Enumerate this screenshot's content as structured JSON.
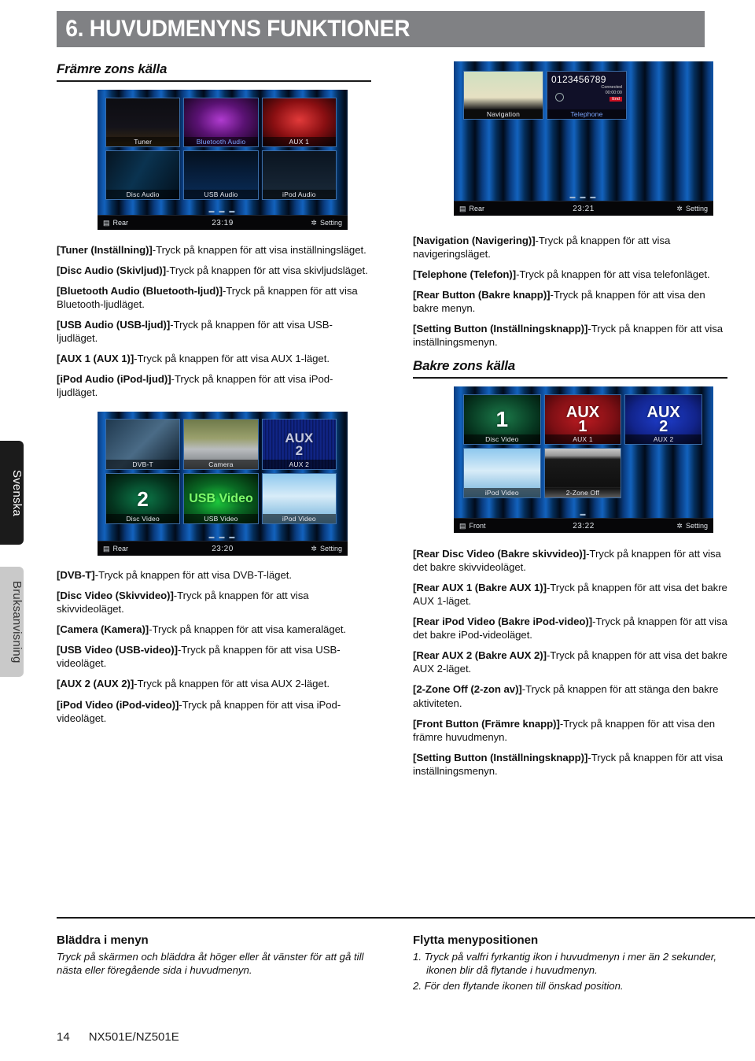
{
  "side_tabs": [
    {
      "label": "Svenska"
    },
    {
      "label": "Bruksanvisning"
    }
  ],
  "chapter": {
    "title": "6. HUVUDMENYNS FUNKTIONER",
    "bar_color": "#808184"
  },
  "left_column": {
    "heading": "Främre zons källa",
    "screenshot_front": {
      "caption_alt": "Front zone source main menu",
      "tiles": [
        {
          "label": "Tuner",
          "big": ""
        },
        {
          "label": "Bluetooth Audio",
          "big": ""
        },
        {
          "label": "AUX 1",
          "big": ""
        },
        {
          "label": "Disc Audio",
          "big": ""
        },
        {
          "label": "USB Audio",
          "big": ""
        },
        {
          "label": "iPod Audio",
          "big": ""
        }
      ],
      "status": {
        "left": "Rear",
        "time": "23:19",
        "right": "Setting"
      },
      "page_dots": "▬ ▬ ▬"
    },
    "items": [
      {
        "term": "[Tuner (Inställning)]",
        "desc": "-Tryck på knappen för att visa inställningsläget."
      },
      {
        "term": "[Disc Audio (Skivljud)]",
        "desc": "-Tryck på knappen för att visa skivljudsläget."
      },
      {
        "term": "[Bluetooth Audio (Bluetooth-ljud)]",
        "desc": "-Tryck på knappen för att visa Bluetooth-ljudläget."
      },
      {
        "term": "[USB Audio (USB-ljud)]",
        "desc": "-Tryck på knappen för att visa USB-ljudläget."
      },
      {
        "term": "[AUX 1 (AUX 1)]",
        "desc": "-Tryck på knappen för att visa AUX 1-läget."
      },
      {
        "term": "[iPod Audio (iPod-ljud)]",
        "desc": "-Tryck på knappen för att visa iPod-ljudläget."
      }
    ],
    "screenshot_video": {
      "caption_alt": "Front zone video sources main menu",
      "tiles": [
        {
          "label": "DVB-T",
          "big": ""
        },
        {
          "label": "Camera",
          "big": ""
        },
        {
          "label": "AUX 2",
          "big": "AUX\n2"
        },
        {
          "label": "Disc Video",
          "big": "2"
        },
        {
          "label": "USB Video",
          "big": "USB Video"
        },
        {
          "label": "iPod Video",
          "big": ""
        }
      ],
      "status": {
        "left": "Rear",
        "time": "23:20",
        "right": "Setting"
      },
      "page_dots": "▬ ▬ ▬"
    },
    "items2": [
      {
        "term": "[DVB-T]",
        "desc": "-Tryck på knappen för att visa DVB-T-läget."
      },
      {
        "term": "[Disc Video (Skivvideo)]",
        "desc": "-Tryck på knappen för att visa skivvideoläget."
      },
      {
        "term": "[Camera (Kamera)]",
        "desc": "-Tryck på knappen för att visa kameraläget."
      },
      {
        "term": "[USB Video (USB-video)]",
        "desc": "-Tryck på knappen för att visa USB-videoläget."
      },
      {
        "term": "[AUX 2 (AUX 2)]",
        "desc": "-Tryck på knappen för att visa AUX 2-läget."
      },
      {
        "term": "[iPod Video (iPod-video)]",
        "desc": "-Tryck på knappen för att visa iPod-videoläget."
      }
    ],
    "tip": {
      "heading": "Bläddra i menyn",
      "body": "Tryck på skärmen och bläddra åt höger eller åt vänster för att gå till nästa eller föregående sida i huvudmenyn."
    }
  },
  "right_column": {
    "screenshot_nav": {
      "caption_alt": "Navigation and Telephone main menu",
      "tiles": [
        {
          "label": "Navigation",
          "big": ""
        },
        {
          "label": "Telephone",
          "big": ""
        }
      ],
      "telephone": {
        "number": "0123456789",
        "connected_label": "Connected",
        "timer": "00:00:00",
        "end_label": "End"
      },
      "status": {
        "left": "Rear",
        "time": "23:21",
        "right": "Setting"
      },
      "page_dots": "▬ ▬ ▬"
    },
    "items": [
      {
        "term": "[Navigation (Navigering)]",
        "desc": "-Tryck på knappen för att visa navigeringsläget."
      },
      {
        "term": "[Telephone (Telefon)]",
        "desc": "-Tryck på knappen för att visa telefonläget."
      },
      {
        "term": "[Rear Button (Bakre knapp)]",
        "desc": "-Tryck på knappen för att visa den bakre menyn."
      },
      {
        "term": "[Setting Button (Inställningsknapp)]",
        "desc": "-Tryck på knappen för att visa inställningsmenyn."
      }
    ],
    "heading": "Bakre zons källa",
    "screenshot_rear": {
      "caption_alt": "Rear zone source main menu",
      "tiles": [
        {
          "label": "Disc Video",
          "big": "1"
        },
        {
          "label": "AUX 1",
          "big": "AUX\n1"
        },
        {
          "label": "AUX 2",
          "big": "AUX\n2"
        },
        {
          "label": "iPod Video",
          "big": ""
        },
        {
          "label": "2-Zone Off",
          "big": ""
        }
      ],
      "status": {
        "left": "Front",
        "time": "23:22",
        "right": "Setting"
      },
      "page_dots": "▬"
    },
    "items2": [
      {
        "term": "[Rear Disc Video (Bakre skivvideo)]",
        "desc": "-Tryck på knappen för att visa det bakre skivvideoläget."
      },
      {
        "term": "[Rear AUX 1 (Bakre AUX 1)]",
        "desc": "-Tryck på knappen för att visa det bakre AUX 1-läget."
      },
      {
        "term": "[Rear iPod Video (Bakre iPod-video)]",
        "desc": "-Tryck på knappen för att visa det bakre iPod-videoläget."
      },
      {
        "term": "[Rear AUX 2 (Bakre AUX 2)]",
        "desc": "-Tryck på knappen för att visa det bakre AUX 2-läget."
      },
      {
        "term": "[2-Zone Off (2-zon av)]",
        "desc": "-Tryck på knappen för att stänga den bakre aktiviteten."
      },
      {
        "term": "[Front Button (Främre knapp)]",
        "desc": "-Tryck på knappen för att visa den främre huvudmenyn."
      },
      {
        "term": "[Setting Button (Inställningsknapp)]",
        "desc": "-Tryck på knappen för att visa inställningsmenyn."
      }
    ],
    "tip": {
      "heading": "Flytta menypositionen",
      "steps": [
        "1. Tryck på valfri fyrkantig ikon i huvudmenyn i mer än 2 sekunder, ikonen blir då flytande i huvudmenyn.",
        "2. För den flytande ikonen till önskad position."
      ]
    }
  },
  "footer": {
    "page_number": "14",
    "model": "NX501E/NZ501E"
  }
}
